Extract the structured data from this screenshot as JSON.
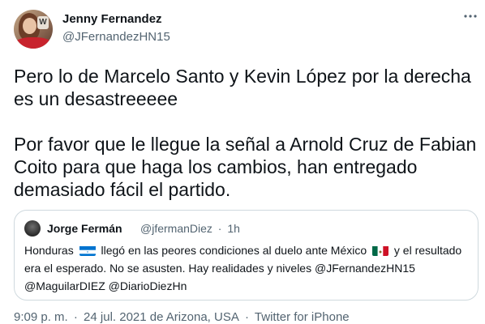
{
  "tweet": {
    "display_name": "Jenny Fernandez",
    "handle": "@JFernandezHN15",
    "more_icon": "more-horizontal-icon",
    "paragraph_1": "Pero lo de Marcelo Santo y Kevin López por la derecha es un desastreeeee",
    "paragraph_2": "Por favor que le llegue la señal a Arnold Cruz de Fabian Coito para que haga los cambios, han entregado demasiado fácil el partido.",
    "timestamp": "9:09 p. m.",
    "separator": "·",
    "date": "24 jul. 2021 de Arizona, USA",
    "source": "Twitter for iPhone"
  },
  "quoted": {
    "display_name": "Jorge Fermán",
    "handle": "@jfermanDiez",
    "separator": "·",
    "time": "1h",
    "text_1": "Honduras",
    "flag_1": "honduras-flag-icon",
    "text_2": "llegó en las peores condiciones al duelo ante México",
    "flag_2": "mexico-flag-icon",
    "text_3": "y el resultado era el esperado. No se asusten. Hay realidades y niveles @JFernandezHN15 @MaguilarDIEZ @DiarioDiezHn"
  },
  "colors": {
    "text_primary": "#0f1419",
    "text_secondary": "#536471",
    "border": "#cfd9de"
  }
}
